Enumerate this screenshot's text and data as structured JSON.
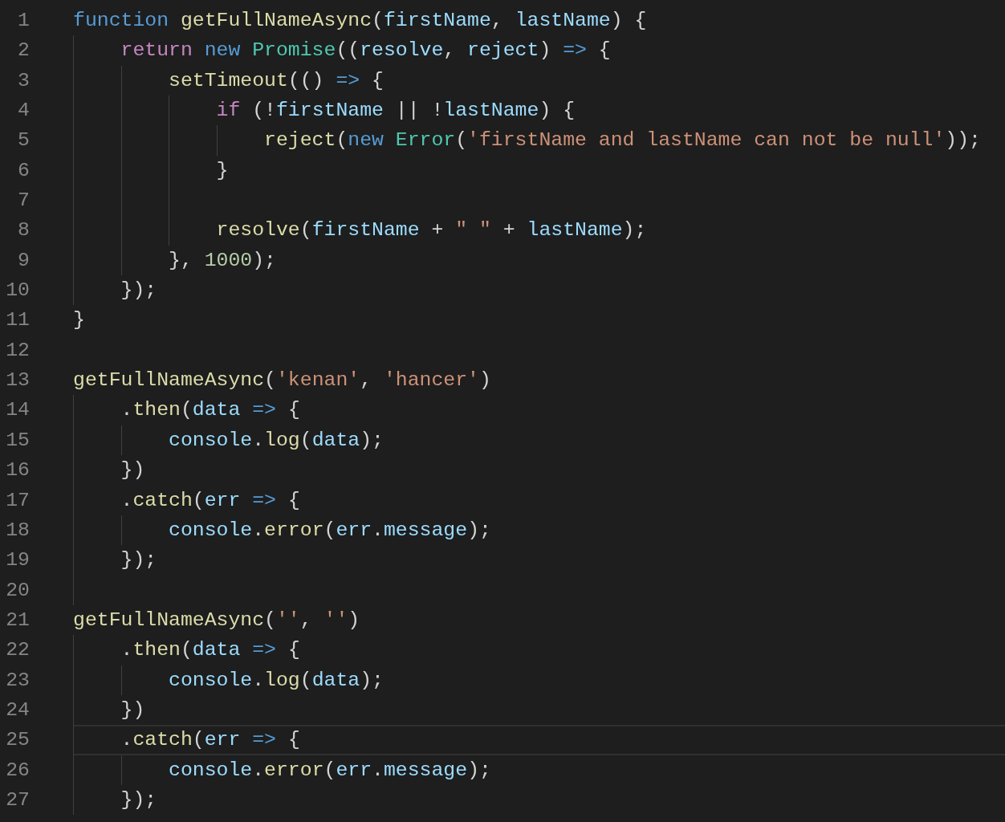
{
  "editor": {
    "lines": [
      {
        "number": "1",
        "current": false,
        "tokens": [
          {
            "text": "function ",
            "kind": "keyword"
          },
          {
            "text": "getFullNameAsync",
            "kind": "function"
          },
          {
            "text": "(",
            "kind": "punct"
          },
          {
            "text": "firstName",
            "kind": "variable"
          },
          {
            "text": ", ",
            "kind": "punct"
          },
          {
            "text": "lastName",
            "kind": "variable"
          },
          {
            "text": ") {",
            "kind": "punct"
          }
        ]
      },
      {
        "number": "2",
        "current": false,
        "tokens": [
          {
            "text": "    return ",
            "kind": "control"
          },
          {
            "text": "new ",
            "kind": "keyword"
          },
          {
            "text": "Promise",
            "kind": "class"
          },
          {
            "text": "((",
            "kind": "punct"
          },
          {
            "text": "resolve",
            "kind": "variable"
          },
          {
            "text": ", ",
            "kind": "punct"
          },
          {
            "text": "reject",
            "kind": "variable"
          },
          {
            "text": ") ",
            "kind": "punct"
          },
          {
            "text": "=>",
            "kind": "keyword"
          },
          {
            "text": " {",
            "kind": "punct"
          }
        ]
      },
      {
        "number": "3",
        "current": false,
        "tokens": [
          {
            "text": "        setTimeout",
            "kind": "function"
          },
          {
            "text": "(() ",
            "kind": "punct"
          },
          {
            "text": "=>",
            "kind": "keyword"
          },
          {
            "text": " {",
            "kind": "punct"
          }
        ]
      },
      {
        "number": "4",
        "current": false,
        "tokens": [
          {
            "text": "            if",
            "kind": "control"
          },
          {
            "text": " (!",
            "kind": "punct"
          },
          {
            "text": "firstName",
            "kind": "variable"
          },
          {
            "text": " || !",
            "kind": "punct"
          },
          {
            "text": "lastName",
            "kind": "variable"
          },
          {
            "text": ") {",
            "kind": "punct"
          }
        ]
      },
      {
        "number": "5",
        "current": false,
        "tokens": [
          {
            "text": "                reject",
            "kind": "function"
          },
          {
            "text": "(",
            "kind": "punct"
          },
          {
            "text": "new ",
            "kind": "keyword"
          },
          {
            "text": "Error",
            "kind": "class"
          },
          {
            "text": "(",
            "kind": "punct"
          },
          {
            "text": "'firstName and lastName can not be null'",
            "kind": "string"
          },
          {
            "text": "));",
            "kind": "punct"
          }
        ]
      },
      {
        "number": "6",
        "current": false,
        "tokens": [
          {
            "text": "            }",
            "kind": "punct"
          }
        ]
      },
      {
        "number": "7",
        "current": false
      },
      {
        "number": "8",
        "current": false,
        "tokens": [
          {
            "text": "            resolve",
            "kind": "function"
          },
          {
            "text": "(",
            "kind": "punct"
          },
          {
            "text": "firstName",
            "kind": "variable"
          },
          {
            "text": " + ",
            "kind": "punct"
          },
          {
            "text": "\" \"",
            "kind": "string"
          },
          {
            "text": " + ",
            "kind": "punct"
          },
          {
            "text": "lastName",
            "kind": "variable"
          },
          {
            "text": ");",
            "kind": "punct"
          }
        ]
      },
      {
        "number": "9",
        "current": false,
        "tokens": [
          {
            "text": "        }, ",
            "kind": "punct"
          },
          {
            "text": "1000",
            "kind": "number"
          },
          {
            "text": ");",
            "kind": "punct"
          }
        ]
      },
      {
        "number": "10",
        "current": false,
        "tokens": [
          {
            "text": "    });",
            "kind": "punct"
          }
        ]
      },
      {
        "number": "11",
        "current": false,
        "tokens": [
          {
            "text": "}",
            "kind": "punct"
          }
        ]
      },
      {
        "number": "12",
        "current": false
      },
      {
        "number": "13",
        "current": false,
        "tokens": [
          {
            "text": "getFullNameAsync",
            "kind": "function"
          },
          {
            "text": "(",
            "kind": "punct"
          },
          {
            "text": "'kenan'",
            "kind": "string"
          },
          {
            "text": ", ",
            "kind": "punct"
          },
          {
            "text": "'hancer'",
            "kind": "string"
          },
          {
            "text": ")",
            "kind": "punct"
          }
        ]
      },
      {
        "number": "14",
        "current": false,
        "tokens": [
          {
            "text": "    .",
            "kind": "punct"
          },
          {
            "text": "then",
            "kind": "function"
          },
          {
            "text": "(",
            "kind": "punct"
          },
          {
            "text": "data ",
            "kind": "variable"
          },
          {
            "text": "=>",
            "kind": "keyword"
          },
          {
            "text": " {",
            "kind": "punct"
          }
        ]
      },
      {
        "number": "15",
        "current": false,
        "tokens": [
          {
            "text": "        console",
            "kind": "variable"
          },
          {
            "text": ".",
            "kind": "punct"
          },
          {
            "text": "log",
            "kind": "function"
          },
          {
            "text": "(",
            "kind": "punct"
          },
          {
            "text": "data",
            "kind": "variable"
          },
          {
            "text": ");",
            "kind": "punct"
          }
        ]
      },
      {
        "number": "16",
        "current": false,
        "tokens": [
          {
            "text": "    })",
            "kind": "punct"
          }
        ]
      },
      {
        "number": "17",
        "current": false,
        "tokens": [
          {
            "text": "    .",
            "kind": "punct"
          },
          {
            "text": "catch",
            "kind": "function"
          },
          {
            "text": "(",
            "kind": "punct"
          },
          {
            "text": "err ",
            "kind": "variable"
          },
          {
            "text": "=>",
            "kind": "keyword"
          },
          {
            "text": " {",
            "kind": "punct"
          }
        ]
      },
      {
        "number": "18",
        "current": false,
        "tokens": [
          {
            "text": "        console",
            "kind": "variable"
          },
          {
            "text": ".",
            "kind": "punct"
          },
          {
            "text": "error",
            "kind": "function"
          },
          {
            "text": "(",
            "kind": "punct"
          },
          {
            "text": "err",
            "kind": "variable"
          },
          {
            "text": ".",
            "kind": "punct"
          },
          {
            "text": "message",
            "kind": "variable"
          },
          {
            "text": ");",
            "kind": "punct"
          }
        ]
      },
      {
        "number": "19",
        "current": false,
        "tokens": [
          {
            "text": "    });",
            "kind": "punct"
          }
        ]
      },
      {
        "number": "20",
        "current": false
      },
      {
        "number": "21",
        "current": false,
        "tokens": [
          {
            "text": "getFullNameAsync",
            "kind": "function"
          },
          {
            "text": "(",
            "kind": "punct"
          },
          {
            "text": "''",
            "kind": "string"
          },
          {
            "text": ", ",
            "kind": "punct"
          },
          {
            "text": "''",
            "kind": "string"
          },
          {
            "text": ")",
            "kind": "punct"
          }
        ]
      },
      {
        "number": "22",
        "current": false,
        "tokens": [
          {
            "text": "    .",
            "kind": "punct"
          },
          {
            "text": "then",
            "kind": "function"
          },
          {
            "text": "(",
            "kind": "punct"
          },
          {
            "text": "data ",
            "kind": "variable"
          },
          {
            "text": "=>",
            "kind": "keyword"
          },
          {
            "text": " {",
            "kind": "punct"
          }
        ]
      },
      {
        "number": "23",
        "current": false,
        "tokens": [
          {
            "text": "        console",
            "kind": "variable"
          },
          {
            "text": ".",
            "kind": "punct"
          },
          {
            "text": "log",
            "kind": "function"
          },
          {
            "text": "(",
            "kind": "punct"
          },
          {
            "text": "data",
            "kind": "variable"
          },
          {
            "text": ");",
            "kind": "punct"
          }
        ]
      },
      {
        "number": "24",
        "current": false,
        "tokens": [
          {
            "text": "    })",
            "kind": "punct"
          }
        ]
      },
      {
        "number": "25",
        "current": true,
        "tokens": [
          {
            "text": "    .",
            "kind": "punct"
          },
          {
            "text": "catch",
            "kind": "function"
          },
          {
            "text": "(",
            "kind": "punct"
          },
          {
            "text": "err ",
            "kind": "variable"
          },
          {
            "text": "=>",
            "kind": "keyword"
          },
          {
            "text": " {",
            "kind": "punct"
          }
        ]
      },
      {
        "number": "26",
        "current": false,
        "tokens": [
          {
            "text": "        console",
            "kind": "variable"
          },
          {
            "text": ".",
            "kind": "punct"
          },
          {
            "text": "error",
            "kind": "function"
          },
          {
            "text": "(",
            "kind": "punct"
          },
          {
            "text": "err",
            "kind": "variable"
          },
          {
            "text": ".",
            "kind": "punct"
          },
          {
            "text": "message",
            "kind": "variable"
          },
          {
            "text": ");",
            "kind": "punct"
          }
        ]
      },
      {
        "number": "27",
        "current": false,
        "tokens": [
          {
            "text": "    });",
            "kind": "punct"
          }
        ]
      }
    ]
  }
}
